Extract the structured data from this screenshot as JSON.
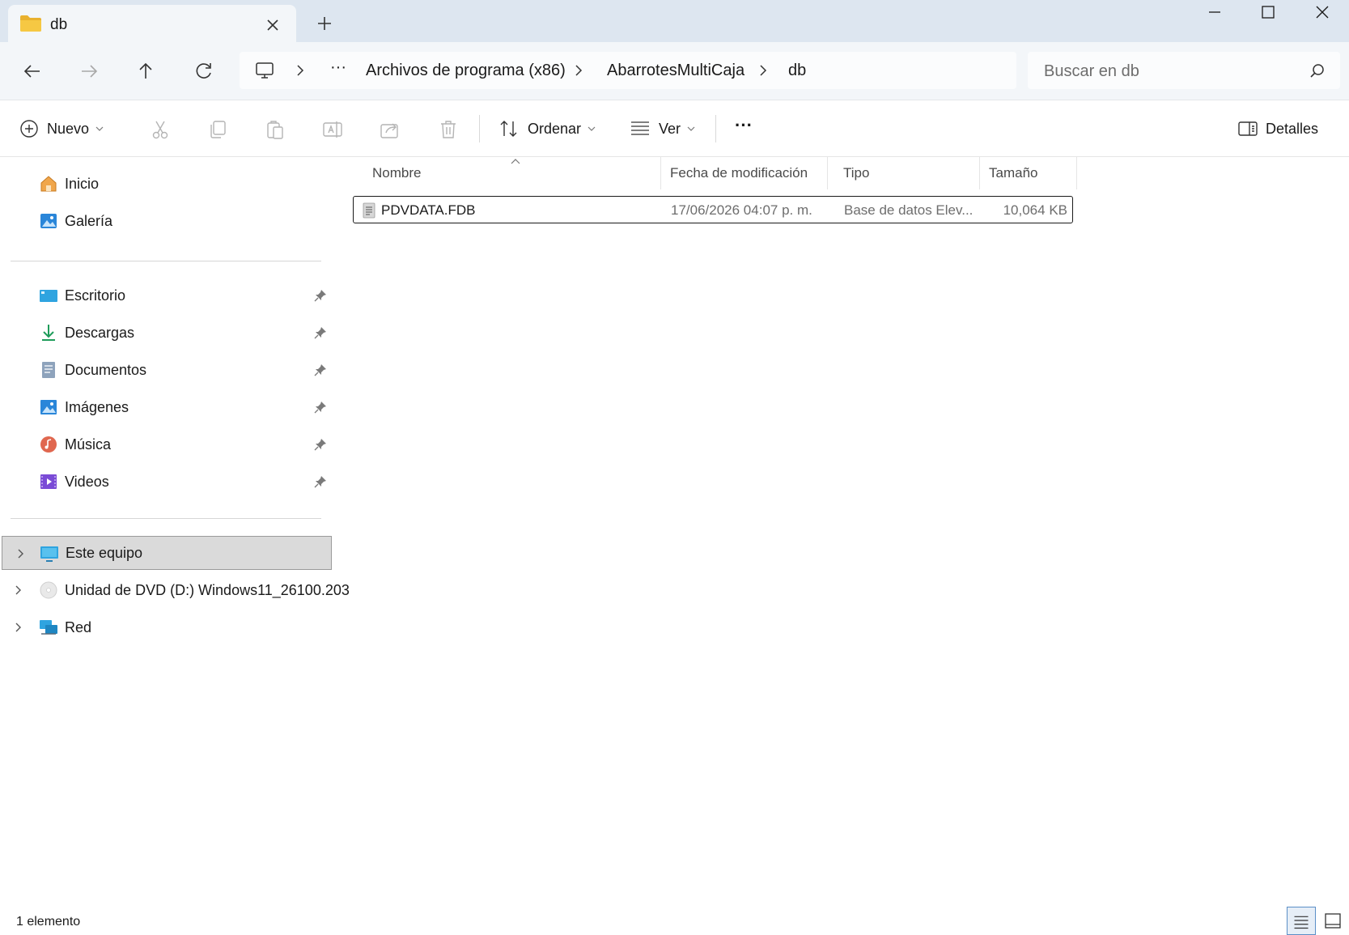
{
  "tab": {
    "title": "db"
  },
  "breadcrumb": {
    "overflow": "···",
    "items": [
      "Archivos de programa (x86)",
      "AbarrotesMultiCaja",
      "db"
    ]
  },
  "search": {
    "placeholder": "Buscar en db"
  },
  "commands": {
    "new_label": "Nuevo",
    "sort_label": "Ordenar",
    "view_label": "Ver",
    "more_label": "···",
    "details_label": "Detalles"
  },
  "sidebar": {
    "top": [
      {
        "label": "Inicio",
        "icon": "home-icon"
      },
      {
        "label": "Galería",
        "icon": "gallery-icon"
      }
    ],
    "pinned": [
      {
        "label": "Escritorio",
        "icon": "desktop-icon"
      },
      {
        "label": "Descargas",
        "icon": "download-icon"
      },
      {
        "label": "Documentos",
        "icon": "documents-icon"
      },
      {
        "label": "Imágenes",
        "icon": "pictures-icon"
      },
      {
        "label": "Música",
        "icon": "music-icon"
      },
      {
        "label": "Videos",
        "icon": "videos-icon"
      }
    ],
    "drives": [
      {
        "label": "Este equipo",
        "icon": "this-pc-icon",
        "selected": true
      },
      {
        "label": "Unidad de DVD (D:) Windows11_26100.203",
        "icon": "dvd-icon"
      },
      {
        "label": "Red",
        "icon": "network-icon"
      }
    ]
  },
  "columns": {
    "name": "Nombre",
    "date": "Fecha de modificación",
    "type": "Tipo",
    "size": "Tamaño"
  },
  "files": [
    {
      "name": "PDVDATA.FDB",
      "date": "17/06/2026 04:07 p. m.",
      "type": "Base de datos Elev...",
      "size": "10,064 KB"
    }
  ],
  "status": {
    "count": "1 elemento"
  },
  "colors": {
    "titlebar": "#dde6f0",
    "navrow": "#f3f6f9",
    "accent": "#0067c0",
    "folder": "#f4c33f"
  }
}
